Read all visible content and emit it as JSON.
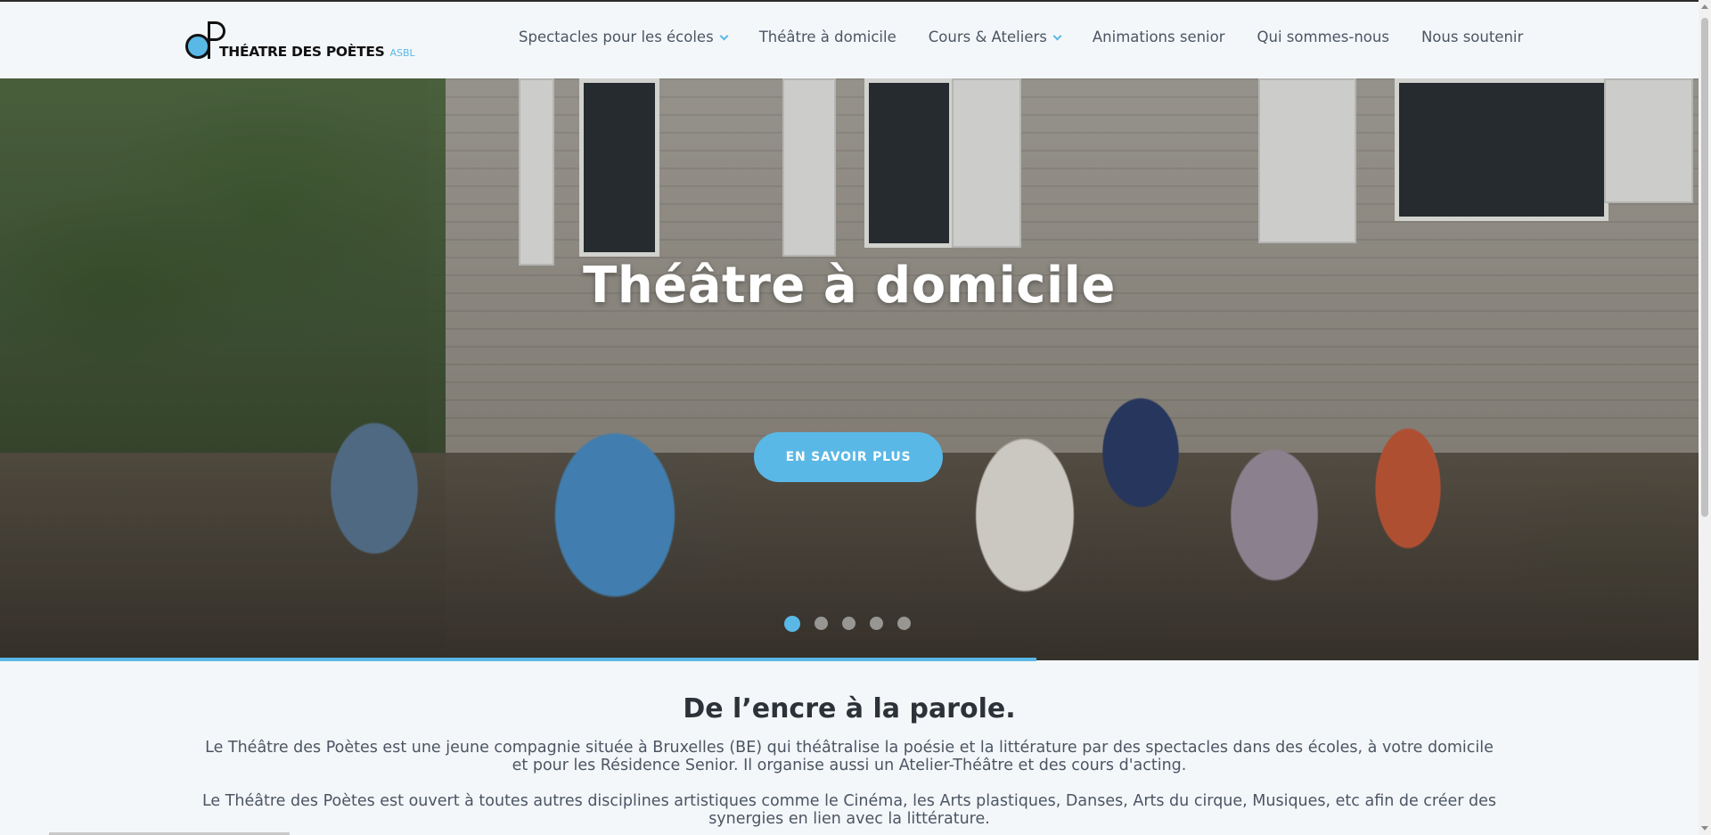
{
  "header": {
    "logo_text": "THÉATRE DES POÈTES",
    "logo_asbl": "ASBL"
  },
  "nav": {
    "items": [
      {
        "label": "Spectacles pour les écoles",
        "dropdown": true
      },
      {
        "label": "Théâtre à domicile",
        "dropdown": false
      },
      {
        "label": "Cours & Ateliers",
        "dropdown": true
      },
      {
        "label": "Animations senior",
        "dropdown": false
      },
      {
        "label": "Qui sommes-nous",
        "dropdown": false
      },
      {
        "label": "Nous soutenir",
        "dropdown": false
      }
    ]
  },
  "hero": {
    "title": "Théâtre à domicile",
    "button_label": "EN SAVOIR PLUS",
    "slide_count": 5,
    "active_slide": 1,
    "progress": 0.61
  },
  "intro": {
    "heading": "De l’encre à la parole.",
    "paragraph_1": "Le Théâtre des Poètes est une jeune compagnie située à Bruxelles (BE) qui théâtralise la poésie et la littérature par des spectacles dans des écoles, à votre domicile et pour les Résidence Senior. Il organise aussi un Atelier-Théâtre et des cours d'acting.",
    "paragraph_2": "Le Théâtre des Poètes est ouvert à toutes autres disciplines artistiques comme le Cinéma, les Arts plastiques, Danses, Arts du cirque, Musiques, etc afin de créer des synergies en lien avec la littérature."
  },
  "colors": {
    "accent": "#5ab8e6",
    "heading": "#2d3138",
    "text": "#4b5563",
    "background": "#f4f7fa"
  }
}
